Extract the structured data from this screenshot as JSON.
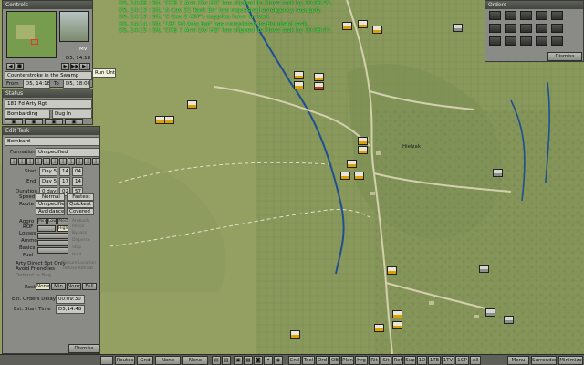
{
  "message_log": [
    "D5, 14:06 : Sit, 'CCB 7 Arm Div HQ' has slipped its Move task by 00:08:22.",
    "D5, 14:13 : Sit, 'A Cav 31 Tank Bn' has requested emergency resupply.",
    "D5, 14:13 : Sit, 'C Cav 2 ASP's supplies have arrived.",
    "D5, 14:14 : Sit, '181 Fd Arty Rgt' has completed its Bombard task.",
    "D5, 14:15 : Sit, 'CCB 7 Arm Div HQ' has slipped its Move task by 00:08:07."
  ],
  "controls": {
    "title": "Controls",
    "date": "D5, 14:18",
    "mode": "MV",
    "scenario": "Counterstroke in the Swamp",
    "from_label": "From",
    "from_value": "D5, 14:18",
    "to_label": "To",
    "to_value": "D5, 18:00",
    "tooltip": "Run Until"
  },
  "status": {
    "title": "Status",
    "unit": "181 Fd Arty Rgt",
    "activity": "Bombarding",
    "posture": "Dug In"
  },
  "edit_task": {
    "title": "Edit Task",
    "task_type": "Bombard",
    "formation_label": "Formation",
    "formation_value": "Unspecified",
    "start_label": "Start",
    "start_day": "Day 5",
    "start_hh": "14",
    "start_mm": "04",
    "end_label": "End",
    "end_day": "Day 5",
    "end_hh": "17",
    "end_mm": "14",
    "duration_label": "Duration",
    "duration_days": "0 days",
    "duration_hh": "02",
    "duration_mm": "57",
    "speed_label": "Speed",
    "speed_options": [
      "Normal",
      "Fastest"
    ],
    "route_label": "Route",
    "route_options": [
      "Unspecified",
      "Quickest",
      "Avoidance",
      "Covered"
    ],
    "aggro_label": "Aggro",
    "rop_label": "ROF",
    "losses_label": "Losses",
    "ammo_label": "Ammo",
    "basics_label": "Basics",
    "fuel_label": "Fuel",
    "level_options": [
      "Min",
      "Low",
      "Med",
      "High"
    ],
    "side_options": [
      "Ambush",
      "Recce",
      "Bypass",
      "Disperse",
      "Stop",
      "Hold"
    ],
    "check_direct": "Arty Direct Spt Only",
    "check_friendlies": "Avoid Friendlies",
    "check_secure": "Secure Location",
    "check_retreat": "Refuse Retreat",
    "check_bog": "Defend in Bog",
    "rest_label": "Rest",
    "rest_options": [
      "None",
      "Min",
      "Norm",
      "Full"
    ],
    "delay_label": "Est. Orders Delay",
    "delay_value": "00:09:30",
    "estart_label": "Est. Start Time",
    "estart_value": "D5,14:48",
    "dismiss": "Dismiss"
  },
  "orders": {
    "title": "Orders",
    "dismiss": "Dismiss"
  },
  "map_labels": {
    "village": "Hielzak"
  },
  "toolbar": {
    "left_blank": "",
    "routes": "Routes",
    "gnd": "Gnd",
    "none_a": "None",
    "none_b": "None",
    "tabs": [
      "Cntl",
      "Tool",
      "Ord",
      "OB",
      "Plan",
      "Hrg",
      "Rlt",
      "Sit",
      "Ref",
      "Sup",
      "1D",
      "1TE",
      "1TV",
      "1CP",
      "All"
    ],
    "menu": "Menu",
    "surrender": "Surrender",
    "minimize": "Minimize"
  },
  "colors": {
    "message_text": "#40f04a",
    "friendly_tag": "#d9a200",
    "enemy_tag": "#8b8f8c",
    "map_field": "#8c9a5c",
    "river": "#1e4f8f"
  }
}
